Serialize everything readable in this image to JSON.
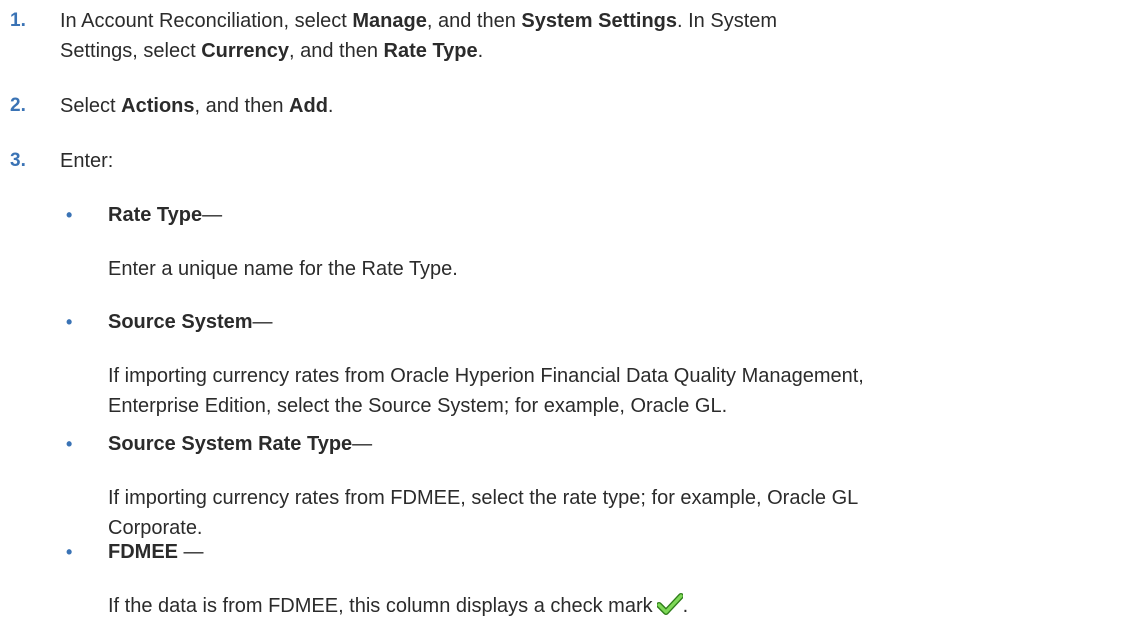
{
  "steps": [
    {
      "number": "1.",
      "parts": [
        {
          "t": "In Account Reconciliation, select "
        },
        {
          "t": "Manage",
          "b": true
        },
        {
          "t": ", and then "
        },
        {
          "t": "System Settings",
          "b": true
        },
        {
          "t": ". In System"
        },
        {
          "br": true
        },
        {
          "t": "Settings, select "
        },
        {
          "t": "Currency",
          "b": true
        },
        {
          "t": ", and then "
        },
        {
          "t": "Rate Type",
          "b": true
        },
        {
          "t": "."
        }
      ]
    },
    {
      "number": "2.",
      "parts": [
        {
          "t": "Select "
        },
        {
          "t": "Actions",
          "b": true
        },
        {
          "t": ", and then "
        },
        {
          "t": "Add",
          "b": true
        },
        {
          "t": "."
        }
      ]
    },
    {
      "number": "3.",
      "parts": [
        {
          "t": "Enter:"
        }
      ]
    }
  ],
  "fields": [
    {
      "bullet": "•",
      "title": "Rate Type",
      "title_suffix": "—",
      "desc_lines": [
        "Enter a unique name for the Rate Type."
      ]
    },
    {
      "bullet": "•",
      "title": "Source System",
      "title_suffix": "—",
      "desc_lines": [
        "If importing currency rates from Oracle Hyperion Financial Data Quality Management,",
        "Enterprise Edition, select the Source System; for example, Oracle GL."
      ]
    },
    {
      "bullet": "•",
      "title": "Source System Rate Type",
      "title_suffix": "—",
      "desc_lines": [
        "If importing currency rates from FDMEE, select the rate type; for example, Oracle GL",
        "Corporate."
      ]
    },
    {
      "bullet": "•",
      "title": "FDMEE",
      "title_suffix": " —",
      "desc_lines": [
        "If the data is from FDMEE, this column displays a check mark"
      ],
      "desc_after_icon": ".",
      "icon": "check-mark-icon"
    }
  ],
  "colors": {
    "accent": "#3a73b5",
    "text": "#2b2b2b",
    "check": "#4caf28"
  }
}
